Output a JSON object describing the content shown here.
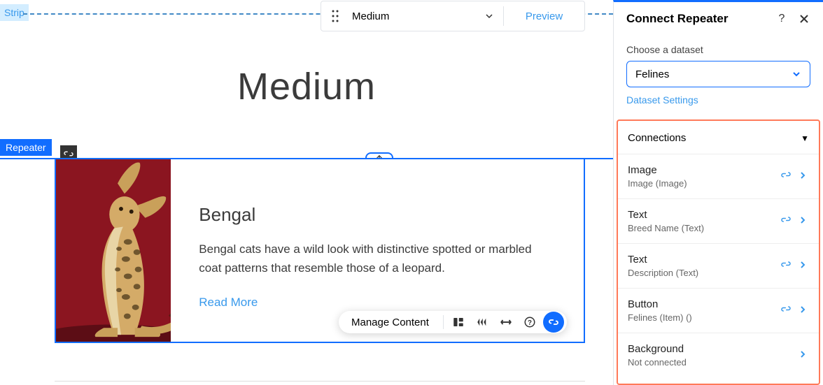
{
  "canvas": {
    "strip_label": "Strip",
    "repeater_label": "Repeater",
    "page_title": "Medium"
  },
  "device_bar": {
    "device_name": "Medium",
    "preview_label": "Preview"
  },
  "item": {
    "title": "Bengal",
    "description": "Bengal cats have a wild look with distinctive spotted or marbled coat patterns that resemble those of a leopard.",
    "read_more": "Read More"
  },
  "item_toolbar": {
    "manage_content": "Manage Content"
  },
  "panel": {
    "title": "Connect Repeater",
    "choose_dataset_label": "Choose a dataset",
    "dataset_value": "Felines",
    "dataset_settings": "Dataset Settings",
    "connections_header": "Connections",
    "rows": [
      {
        "name": "Image",
        "sub": "Image (Image)",
        "linked": true
      },
      {
        "name": "Text",
        "sub": "Breed Name (Text)",
        "linked": true
      },
      {
        "name": "Text",
        "sub": "Description (Text)",
        "linked": true
      },
      {
        "name": "Button",
        "sub": "Felines (Item) ()",
        "linked": true
      },
      {
        "name": "Background",
        "sub": "Not connected",
        "linked": false
      }
    ]
  }
}
